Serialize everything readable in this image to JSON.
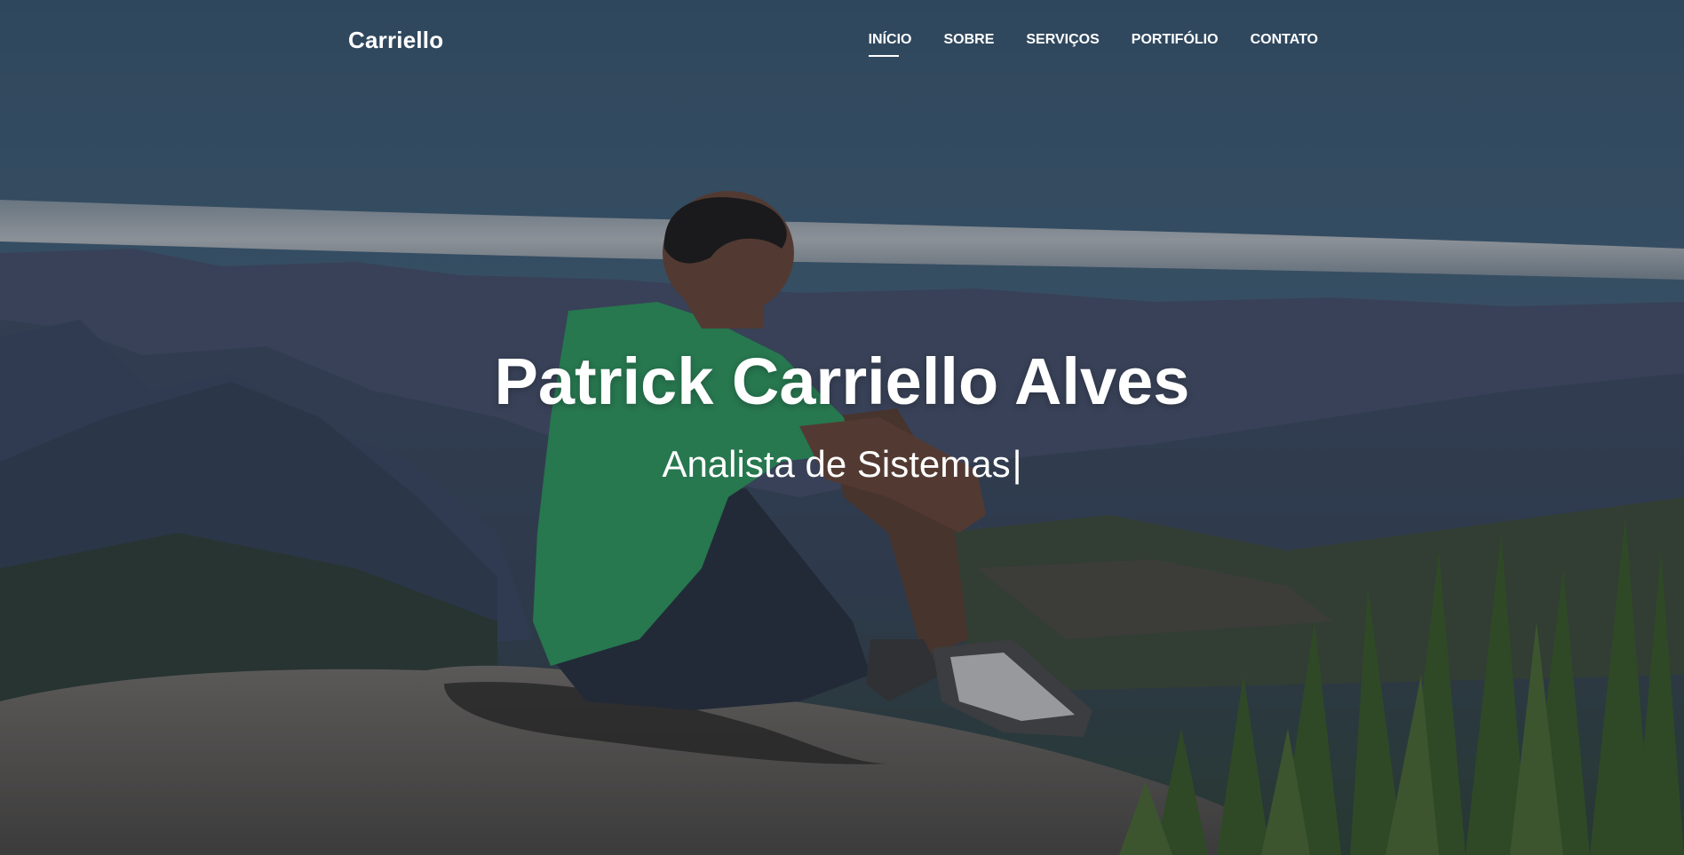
{
  "brand": "Carriello",
  "nav": {
    "items": [
      {
        "label": "INÍCIO",
        "active": true
      },
      {
        "label": "SOBRE",
        "active": false
      },
      {
        "label": "SERVIÇOS",
        "active": false
      },
      {
        "label": "PORTIFÓLIO",
        "active": false
      },
      {
        "label": "CONTATO",
        "active": false
      }
    ]
  },
  "hero": {
    "title": "Patrick Carriello Alves",
    "subtitle": "Analista de Sistemas",
    "cursor": "|"
  },
  "colors": {
    "text": "#ffffff",
    "sky": "#3c5c74",
    "shirt": "#2f9a5f",
    "rock": "#6a6560",
    "plants": "#3e5c2a"
  }
}
